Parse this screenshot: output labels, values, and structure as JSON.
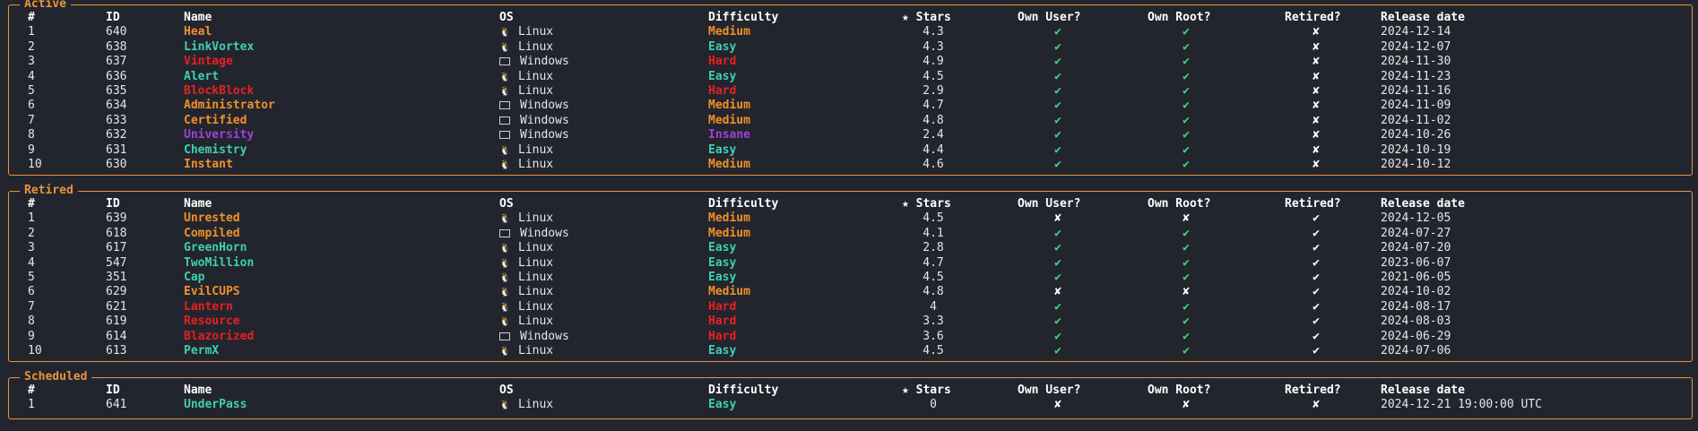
{
  "colors": {
    "accent": "#e8943a",
    "easy": "#3ed0b0",
    "medium": "#f0902a",
    "hard": "#e82020",
    "insane": "#a040d8",
    "yes": "#3ed87a",
    "no": "#ffffff"
  },
  "headers": {
    "num": "#",
    "id": "ID",
    "name": "Name",
    "os": "OS",
    "difficulty": "Difficulty",
    "stars": "★ Stars",
    "own_user": "Own User?",
    "own_root": "Own Root?",
    "retired": "Retired?",
    "release_date": "Release date"
  },
  "sections": [
    {
      "key": "active",
      "title": "Active",
      "rows": [
        {
          "num": "1",
          "id": "640",
          "name": "Heal",
          "os": "Linux",
          "difficulty": "Medium",
          "stars": "4.3",
          "own_user": "✔",
          "own_root": "✔",
          "retired": "✘",
          "date": "2024-12-14"
        },
        {
          "num": "2",
          "id": "638",
          "name": "LinkVortex",
          "os": "Linux",
          "difficulty": "Easy",
          "stars": "4.3",
          "own_user": "✔",
          "own_root": "✔",
          "retired": "✘",
          "date": "2024-12-07"
        },
        {
          "num": "3",
          "id": "637",
          "name": "Vintage",
          "os": "Windows",
          "difficulty": "Hard",
          "stars": "4.9",
          "own_user": "✔",
          "own_root": "✔",
          "retired": "✘",
          "date": "2024-11-30"
        },
        {
          "num": "4",
          "id": "636",
          "name": "Alert",
          "os": "Linux",
          "difficulty": "Easy",
          "stars": "4.5",
          "own_user": "✔",
          "own_root": "✔",
          "retired": "✘",
          "date": "2024-11-23"
        },
        {
          "num": "5",
          "id": "635",
          "name": "BlockBlock",
          "os": "Linux",
          "difficulty": "Hard",
          "stars": "2.9",
          "own_user": "✔",
          "own_root": "✔",
          "retired": "✘",
          "date": "2024-11-16"
        },
        {
          "num": "6",
          "id": "634",
          "name": "Administrator",
          "os": "Windows",
          "difficulty": "Medium",
          "stars": "4.7",
          "own_user": "✔",
          "own_root": "✔",
          "retired": "✘",
          "date": "2024-11-09"
        },
        {
          "num": "7",
          "id": "633",
          "name": "Certified",
          "os": "Windows",
          "difficulty": "Medium",
          "stars": "4.8",
          "own_user": "✔",
          "own_root": "✔",
          "retired": "✘",
          "date": "2024-11-02"
        },
        {
          "num": "8",
          "id": "632",
          "name": "University",
          "os": "Windows",
          "difficulty": "Insane",
          "stars": "2.4",
          "own_user": "✔",
          "own_root": "✔",
          "retired": "✘",
          "date": "2024-10-26"
        },
        {
          "num": "9",
          "id": "631",
          "name": "Chemistry",
          "os": "Linux",
          "difficulty": "Easy",
          "stars": "4.4",
          "own_user": "✔",
          "own_root": "✔",
          "retired": "✘",
          "date": "2024-10-19"
        },
        {
          "num": "10",
          "id": "630",
          "name": "Instant",
          "os": "Linux",
          "difficulty": "Medium",
          "stars": "4.6",
          "own_user": "✔",
          "own_root": "✔",
          "retired": "✘",
          "date": "2024-10-12"
        }
      ]
    },
    {
      "key": "retired",
      "title": "Retired",
      "rows": [
        {
          "num": "1",
          "id": "639",
          "name": "Unrested",
          "os": "Linux",
          "difficulty": "Medium",
          "stars": "4.5",
          "own_user": "✘",
          "own_root": "✘",
          "retired": "✔",
          "date": "2024-12-05"
        },
        {
          "num": "2",
          "id": "618",
          "name": "Compiled",
          "os": "Windows",
          "difficulty": "Medium",
          "stars": "4.1",
          "own_user": "✔",
          "own_root": "✔",
          "retired": "✔",
          "date": "2024-07-27"
        },
        {
          "num": "3",
          "id": "617",
          "name": "GreenHorn",
          "os": "Linux",
          "difficulty": "Easy",
          "stars": "2.8",
          "own_user": "✔",
          "own_root": "✔",
          "retired": "✔",
          "date": "2024-07-20"
        },
        {
          "num": "4",
          "id": "547",
          "name": "TwoMillion",
          "os": "Linux",
          "difficulty": "Easy",
          "stars": "4.7",
          "own_user": "✔",
          "own_root": "✔",
          "retired": "✔",
          "date": "2023-06-07"
        },
        {
          "num": "5",
          "id": "351",
          "name": "Cap",
          "os": "Linux",
          "difficulty": "Easy",
          "stars": "4.5",
          "own_user": "✔",
          "own_root": "✔",
          "retired": "✔",
          "date": "2021-06-05"
        },
        {
          "num": "6",
          "id": "629",
          "name": "EvilCUPS",
          "os": "Linux",
          "difficulty": "Medium",
          "stars": "4.8",
          "own_user": "✘",
          "own_root": "✘",
          "retired": "✔",
          "date": "2024-10-02"
        },
        {
          "num": "7",
          "id": "621",
          "name": "Lantern",
          "os": "Linux",
          "difficulty": "Hard",
          "stars": "4",
          "own_user": "✔",
          "own_root": "✔",
          "retired": "✔",
          "date": "2024-08-17"
        },
        {
          "num": "8",
          "id": "619",
          "name": "Resource",
          "os": "Linux",
          "difficulty": "Hard",
          "stars": "3.3",
          "own_user": "✔",
          "own_root": "✔",
          "retired": "✔",
          "date": "2024-08-03"
        },
        {
          "num": "9",
          "id": "614",
          "name": "Blazorized",
          "os": "Windows",
          "difficulty": "Hard",
          "stars": "3.6",
          "own_user": "✔",
          "own_root": "✔",
          "retired": "✔",
          "date": "2024-06-29"
        },
        {
          "num": "10",
          "id": "613",
          "name": "PermX",
          "os": "Linux",
          "difficulty": "Easy",
          "stars": "4.5",
          "own_user": "✔",
          "own_root": "✔",
          "retired": "✔",
          "date": "2024-07-06"
        }
      ]
    },
    {
      "key": "scheduled",
      "title": "Scheduled",
      "rows": [
        {
          "num": "1",
          "id": "641",
          "name": "UnderPass",
          "os": "Linux",
          "difficulty": "Easy",
          "stars": "0",
          "own_user": "✘",
          "own_root": "✘",
          "retired": "✘",
          "date": "2024-12-21 19:00:00 UTC"
        }
      ]
    }
  ]
}
